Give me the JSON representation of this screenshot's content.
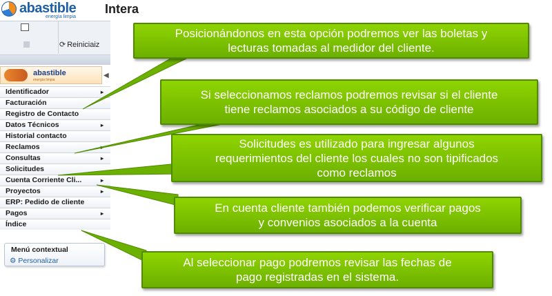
{
  "header": {
    "logo_text": "abastible",
    "logo_tagline": "energía limpia",
    "app_title_partial": "Intera"
  },
  "toolbar": {
    "reinicializar_label": "Reiniciaiz"
  },
  "banner": {
    "text": "abastible",
    "sub": "energía limpia"
  },
  "menu": {
    "items": [
      {
        "label": "Identificador",
        "has_submenu": true
      },
      {
        "label": "Facturación",
        "has_submenu": false
      },
      {
        "label": "Registro de Contacto",
        "has_submenu": false
      },
      {
        "label": "Datos Técnicos",
        "has_submenu": true
      },
      {
        "label": "Historial contacto",
        "has_submenu": false
      },
      {
        "label": "Reclamos",
        "has_submenu": true
      },
      {
        "label": "Consultas",
        "has_submenu": true
      },
      {
        "label": "Solicitudes",
        "has_submenu": false
      },
      {
        "label": "Cuenta Corriente Cli...",
        "has_submenu": true
      },
      {
        "label": "Proyectos",
        "has_submenu": true
      },
      {
        "label": "ERP: Pedido de cliente",
        "has_submenu": false
      },
      {
        "label": "Pagos",
        "has_submenu": true
      },
      {
        "label": "Índice",
        "has_submenu": false
      }
    ],
    "submenu_arrow": "▸"
  },
  "context_menu": {
    "title": "Menú contextual",
    "personalize": "Personalizar"
  },
  "callouts": [
    {
      "line1": "Posicionándonos en esta opción podremos ver las boletas y",
      "line2": "lecturas tomadas al medidor del cliente."
    },
    {
      "line1": "Si seleccionamos reclamos podremos revisar si el cliente",
      "line2": "tiene reclamos asociados a su código de cliente"
    },
    {
      "line1": "Solicitudes es utilizado para ingresar algunos",
      "line2": "requerimientos del cliente los cuales no son tipificados",
      "line3": "como reclamos"
    },
    {
      "line1": "En cuenta cliente también podemos verificar pagos",
      "line2": "y convenios asociados a la cuenta"
    },
    {
      "line1": "Al seleccionar pago podremos revisar las fechas de",
      "line2": "pago registradas en el sistema."
    }
  ],
  "colors": {
    "callout_fill": "#7cc300",
    "callout_border": "#4f8a00",
    "brand_blue": "#1e5fa8",
    "brand_orange": "#f28c1a"
  }
}
